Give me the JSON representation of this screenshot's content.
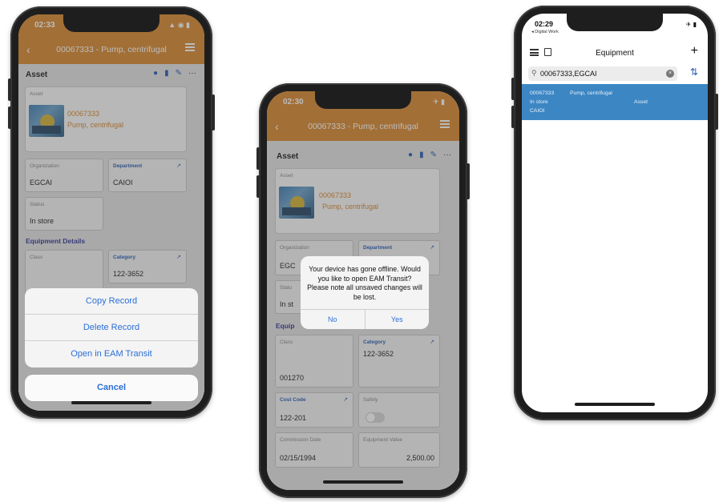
{
  "phone1": {
    "status_time": "02:33",
    "status_icons": "▲ ◉ ▮",
    "header_title": "00067333 - Pump, centrifugal",
    "card_title": "Asset",
    "asset_label": "Asset",
    "asset_code": "00067333",
    "asset_desc": "Pump, centrifugal",
    "org_label": "Organization",
    "org_value": "EGCAI",
    "dept_label": "Department",
    "dept_value": "CAIOI",
    "status_label": "Status",
    "status_value": "In store",
    "section_label": "Equipment Details",
    "class_label": "Class",
    "category_label": "Category",
    "category_value": "122-3652",
    "sheet_items": [
      "Copy Record",
      "Delete Record",
      "Open in EAM Transit"
    ],
    "cancel_label": "Cancel"
  },
  "phone2": {
    "status_time": "02:30",
    "status_icons": "✈ ▮",
    "header_title": "00067333 - Pump, centrifugal",
    "card_title": "Asset",
    "asset_label": "Asset",
    "asset_code": "00067333",
    "asset_desc": "Pump, centrifugal",
    "org_label": "Organization",
    "org_value_partial": "EGC",
    "dept_label": "Department",
    "status_label_partial": "Statu",
    "status_value_partial": "In st",
    "section_partial": "Equip",
    "class_label": "Class",
    "class_value": "001270",
    "category_label": "Category",
    "category_value": "122-3652",
    "cost_code_label": "Cost Code",
    "cost_code_value": "122-201",
    "safety_label": "Safety",
    "commission_label": "Commission Date",
    "commission_value": "02/15/1994",
    "equip_value_label": "Equipment Value",
    "equip_value": "2,500.00",
    "alert_message": "Your device has gone offline. Would you like to open EAM Transit? Please note all unsaved changes will be lost.",
    "alert_no": "No",
    "alert_yes": "Yes"
  },
  "phone3": {
    "status_time": "02:29",
    "back_label": "◂ Digital Work",
    "status_icons": "✈ ▮",
    "title": "Equipment",
    "search_value": "00067333,EGCAI",
    "row_code": "00067333",
    "row_desc": "Pump, centrifugal",
    "row_status": "In store",
    "row_type": "Asset",
    "row_dept": "CAIOI"
  },
  "colors": {
    "header_orange": "#d98a34",
    "ios_blue": "#2b6fd6",
    "selected_row": "#3d86c4"
  }
}
